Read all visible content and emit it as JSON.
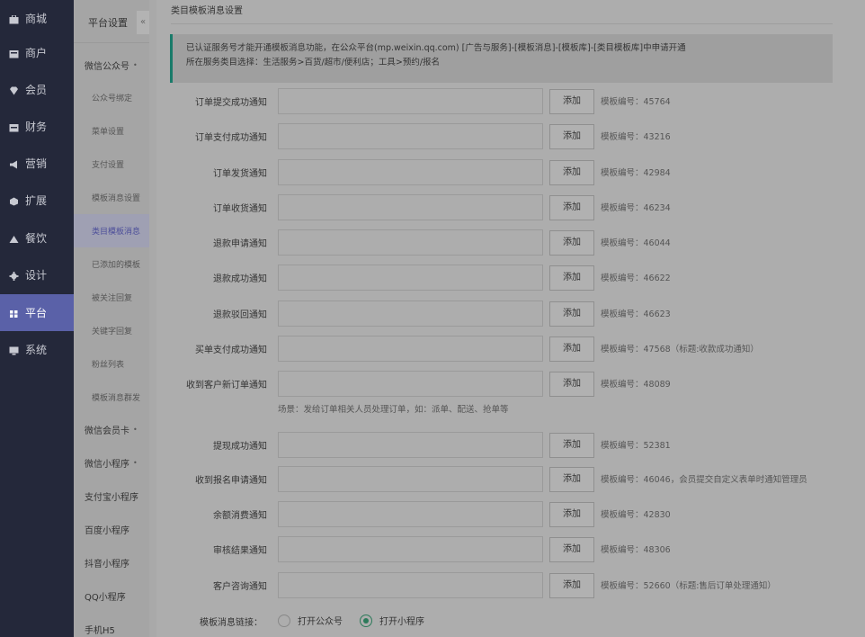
{
  "nav": {
    "items": [
      {
        "label": "商城",
        "icon": "store-icon"
      },
      {
        "label": "商户",
        "icon": "merchant-icon"
      },
      {
        "label": "会员",
        "icon": "diamond-icon"
      },
      {
        "label": "财务",
        "icon": "wallet-icon"
      },
      {
        "label": "营销",
        "icon": "megaphone-icon"
      },
      {
        "label": "扩展",
        "icon": "puzzle-icon"
      },
      {
        "label": "餐饮",
        "icon": "triangle-icon"
      },
      {
        "label": "设计",
        "icon": "gear-icon"
      },
      {
        "label": "平台",
        "icon": "grid-icon",
        "active": true
      },
      {
        "label": "系统",
        "icon": "monitor-icon"
      }
    ]
  },
  "sidebar": {
    "title": "平台设置",
    "collapse_glyph": "«",
    "items": [
      {
        "label": "微信公众号",
        "caret": "•"
      },
      {
        "label": "公众号绑定"
      },
      {
        "label": "菜单设置"
      },
      {
        "label": "支付设置"
      },
      {
        "label": "模板消息设置"
      },
      {
        "label": "类目模板消息"
      },
      {
        "label": "已添加的模板"
      },
      {
        "label": "被关注回复"
      },
      {
        "label": "关键字回复"
      },
      {
        "label": "粉丝列表"
      },
      {
        "label": "模板消息群发"
      },
      {
        "label": "微信会员卡",
        "caret": "•"
      },
      {
        "label": "微信小程序",
        "caret": "•"
      },
      {
        "label": "支付宝小程序"
      },
      {
        "label": "百度小程序"
      },
      {
        "label": "抖音小程序"
      },
      {
        "label": "QQ小程序"
      },
      {
        "label": "手机H5"
      }
    ]
  },
  "main": {
    "title": "类目模板消息设置",
    "notice_line1": "已认证服务号才能开通模板消息功能，在公众平台(mp.weixin.qq.com) [广告与服务]-[模板消息]-[模板库]-[类目模板库]中申请开通",
    "notice_line2": "所在服务类目选择：生活服务>百货/超市/便利店；工具>预约/报名",
    "add_label": "添加",
    "rows": [
      {
        "label": "订单提交成功通知",
        "value": "",
        "tpl": "模板编号：45764"
      },
      {
        "label": "订单支付成功通知",
        "value": "",
        "tpl": "模板编号：43216"
      },
      {
        "label": "订单发货通知",
        "value": "",
        "tpl": "模板编号：42984"
      },
      {
        "label": "订单收货通知",
        "value": "",
        "tpl": "模板编号：46234"
      },
      {
        "label": "退款申请通知",
        "value": "",
        "tpl": "模板编号：46044"
      },
      {
        "label": "退款成功通知",
        "value": "",
        "tpl": "模板编号：46622"
      },
      {
        "label": "退款驳回通知",
        "value": "",
        "tpl": "模板编号：46623"
      },
      {
        "label": "买单支付成功通知",
        "value": "",
        "tpl": "模板编号：47568（标题:收款成功通知）"
      },
      {
        "label": "收到客户新订单通知",
        "value": "",
        "tpl": "模板编号：48089"
      },
      {
        "label": "提现成功通知",
        "value": "",
        "tpl": "模板编号：52381"
      },
      {
        "label": "收到报名申请通知",
        "value": "",
        "tpl": "模板编号：46046，会员提交自定义表单时通知管理员"
      },
      {
        "label": "余额消费通知",
        "value": "",
        "tpl": "模板编号：42830"
      },
      {
        "label": "审核结果通知",
        "value": "",
        "tpl": "模板编号：48306"
      },
      {
        "label": "客户咨询通知",
        "value": "",
        "tpl": "模板编号：52660（标题:售后订单处理通知）"
      }
    ],
    "scene_hint": "场景：发给订单相关人员处理订单，如：派单、配送、抢单等",
    "link_label": "模板消息链接：",
    "link_options": [
      {
        "label": "打开公众号",
        "checked": false
      },
      {
        "label": "打开小程序",
        "checked": true
      }
    ]
  }
}
